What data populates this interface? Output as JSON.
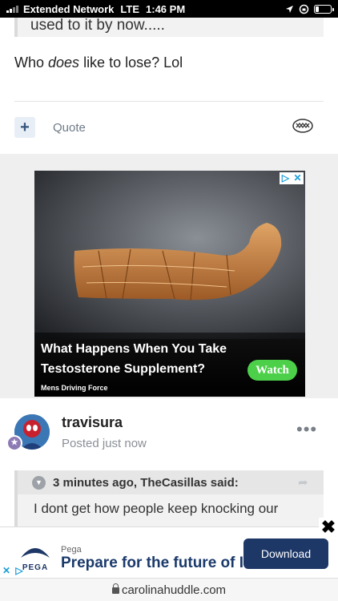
{
  "status_bar": {
    "carrier": "Extended Network",
    "network": "LTE",
    "time": "1:46 PM",
    "battery_level": 0.2
  },
  "previous_post": {
    "quote_tail": "used to it by now.....",
    "text_before": "Who ",
    "text_emphasis": "does",
    "text_after": " like to lose?  Lol",
    "add_label": "+",
    "quote_label": "Quote"
  },
  "ad": {
    "headline": "What Happens When You Take Testosterone Supplement?",
    "cta": "Watch",
    "sponsor": "Mens Driving Force",
    "choices_icons": [
      "adchoices-icon",
      "close-icon"
    ],
    "cta_color": "#4cd04a"
  },
  "reply": {
    "username": "travisura",
    "posted": "Posted just now",
    "more": "•••",
    "quote_attribution": "3 minutes ago, TheCasillas said:",
    "quote_text": "I dont get how people keep knocking our"
  },
  "banner": {
    "brand": "Pega",
    "logo_text": "PEGA",
    "headline": "Prepare for the future of IT",
    "cta": "Download",
    "close": "✖",
    "cta_color": "#1d3767"
  },
  "browser": {
    "url": "carolinahuddle.com"
  }
}
